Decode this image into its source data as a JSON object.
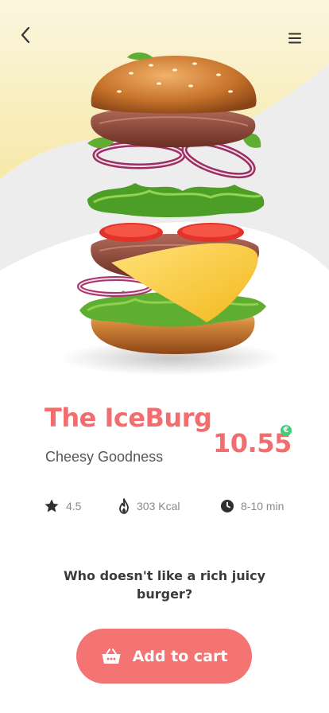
{
  "header": {
    "back_icon": "chevron-left-icon",
    "menu_icon": "hamburger-menu-icon"
  },
  "product": {
    "name": "The IceBurg",
    "subtitle": "Cheesy Goodness",
    "price": "10.55",
    "currency": "€",
    "image": "burger-image"
  },
  "stats": {
    "rating": "4.5",
    "calories": "303 Kcal",
    "time": "8-10 min"
  },
  "tagline": "Who doesn't like a rich juicy burger?",
  "cart_button": {
    "label": "Add to cart",
    "icon": "basket-icon"
  },
  "colors": {
    "accent": "#f26d6d",
    "button": "#f47373",
    "hero_yellow": "#f8efb8",
    "hero_gray": "#ececec",
    "currency_badge": "#3ecf7a"
  }
}
